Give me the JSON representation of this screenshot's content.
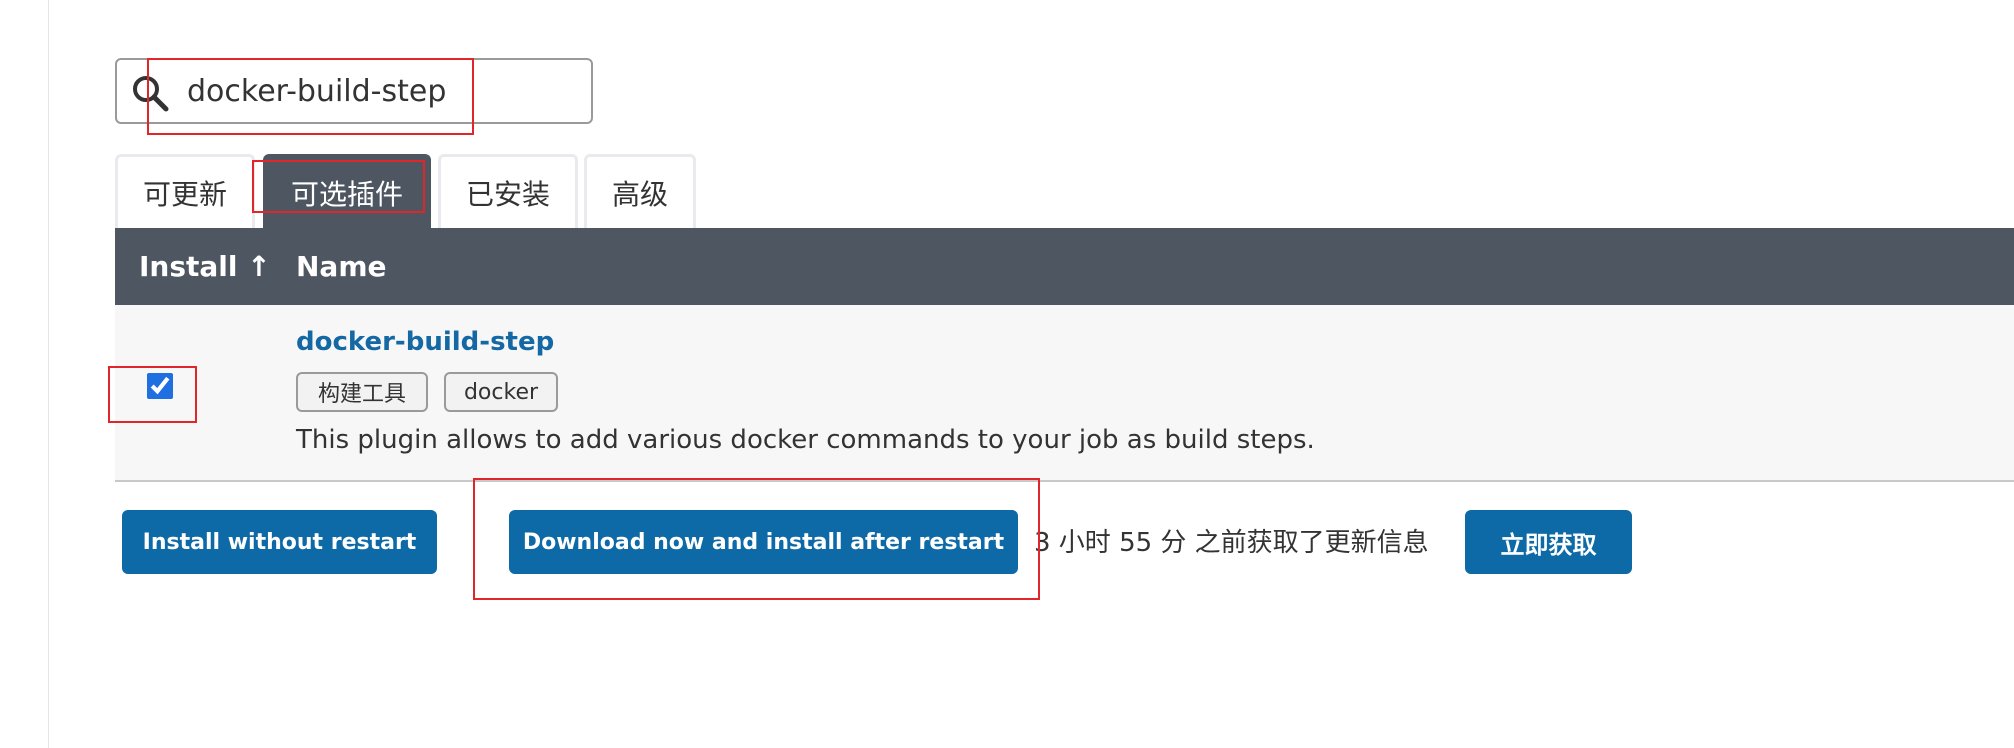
{
  "search": {
    "value": "docker-build-step",
    "icon": "search-icon"
  },
  "tabs": [
    {
      "label": "可更新",
      "active": false
    },
    {
      "label": "可选插件",
      "active": true
    },
    {
      "label": "已安装",
      "active": false
    },
    {
      "label": "高级",
      "active": false
    }
  ],
  "table": {
    "headers": {
      "install": "Install ↑",
      "name": "Name"
    },
    "rows": [
      {
        "checked": true,
        "name": "docker-build-step",
        "tags": [
          "构建工具",
          "docker"
        ],
        "description": "This plugin allows to add various docker commands to your job as build steps."
      }
    ]
  },
  "actions": {
    "install_without_restart": "Install without restart",
    "download_and_install_after_restart": "Download now and install after restart",
    "update_info": "3 小时 55 分 之前获取了更新信息",
    "fetch_now": "立即获取"
  },
  "colors": {
    "header_bg": "#4e5661",
    "button_bg": "#0e6aa6",
    "link": "#1468a3",
    "highlight": "#e0262b"
  }
}
